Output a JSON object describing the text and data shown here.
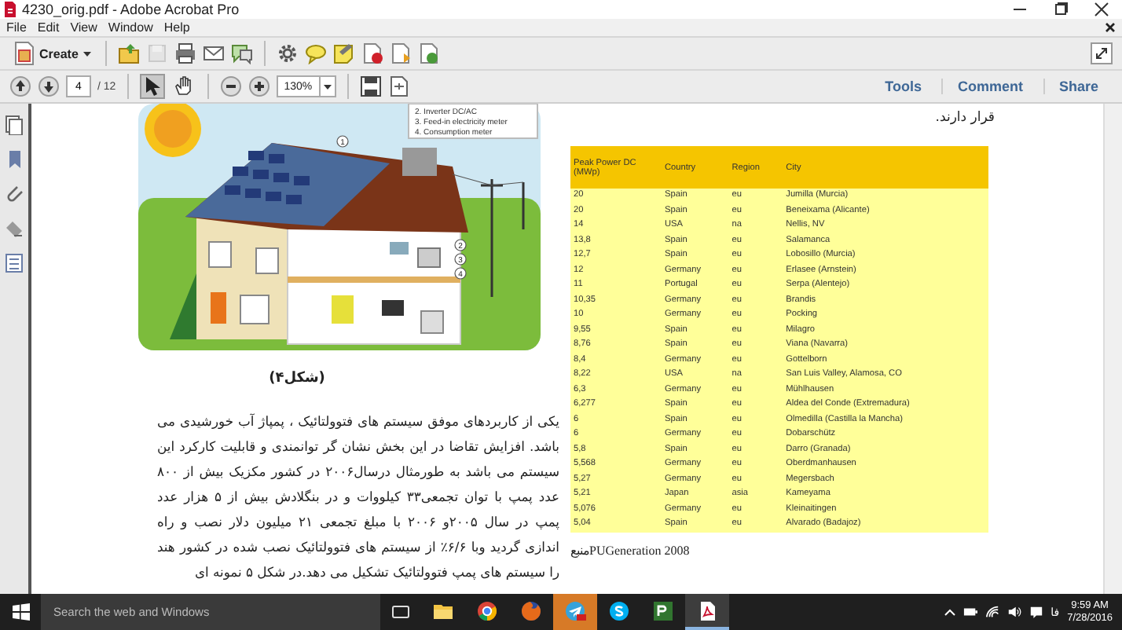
{
  "window": {
    "title": "4230_orig.pdf - Adobe Acrobat Pro"
  },
  "menu": [
    "File",
    "Edit",
    "View",
    "Window",
    "Help"
  ],
  "toolbar": {
    "create": "Create",
    "tools": [
      {
        "kind": "open"
      },
      {
        "kind": "save",
        "disabled": true
      },
      {
        "kind": "print"
      },
      {
        "kind": "mail"
      },
      {
        "kind": "review"
      },
      {
        "kind": "gear"
      },
      {
        "kind": "comment"
      },
      {
        "kind": "sticky"
      },
      {
        "kind": "stamp"
      },
      {
        "kind": "attach"
      },
      {
        "kind": "sign"
      }
    ]
  },
  "nav": {
    "page": "4",
    "total": "/ 12",
    "zoom": "130%",
    "pointers": [
      {
        "kind": "select",
        "selected": true
      },
      {
        "kind": "hand",
        "selected": false
      }
    ]
  },
  "panels": [
    "Tools",
    "Comment",
    "Share"
  ],
  "document": {
    "figure": {
      "legend": [
        "2. Inverter DC/AC",
        "3. Feed-in electricity meter",
        "4. Consumption meter"
      ],
      "markers": [
        "1",
        "2",
        "3",
        "4"
      ]
    },
    "caption": "(شکل۴)",
    "paragraph": "یکی از کاربردهای موفق سیستم های فتوولتائیک ، پمپاژ آب خورشیدی می باشد. افزایش تقاضا در این بخش نشان گر توانمندی و قابلیت کارکرد این سیستم می باشد به طورمثال درسال۲۰۰۶ در کشور مکزیک بیش از ۸۰۰ عدد پمپ با توان تجمعی۳۳ کیلووات و در بنگلادش بیش از ۵ هزار عدد پمپ در سال ۲۰۰۵و ۲۰۰۶ با مبلغ تجمعی ۲۱ میلیون دلار نصب و راه اندازی گردید وبا ۶/۶٪ از سیستم های فتوولتائیک نصب شده در کشور هند را سیستم های پمپ فتوولتائیک تشکیل می دهد.در شکل ۵ نمونه ای",
    "intro": "قرار دارند.",
    "table": {
      "columns": [
        "Peak Power DC (MWp)",
        "Country",
        "Region",
        "City"
      ],
      "rows": [
        [
          "20",
          "Spain",
          "eu",
          "Jumilla (Murcia)"
        ],
        [
          "20",
          "Spain",
          "eu",
          "Beneixama (Alicante)"
        ],
        [
          "14",
          "USA",
          "na",
          "Nellis, NV"
        ],
        [
          "13,8",
          "Spain",
          "eu",
          "Salamanca"
        ],
        [
          "12,7",
          "Spain",
          "eu",
          "Lobosillo (Murcia)"
        ],
        [
          "12",
          "Germany",
          "eu",
          "Erlasee (Arnstein)"
        ],
        [
          "11",
          "Portugal",
          "eu",
          "Serpa (Alentejo)"
        ],
        [
          "10,35",
          "Germany",
          "eu",
          "Brandis"
        ],
        [
          "10",
          "Germany",
          "eu",
          "Pocking"
        ],
        [
          "9,55",
          "Spain",
          "eu",
          "Milagro"
        ],
        [
          "8,76",
          "Spain",
          "eu",
          "Viana (Navarra)"
        ],
        [
          "8,4",
          "Germany",
          "eu",
          "Gottelborn"
        ],
        [
          "8,22",
          "USA",
          "na",
          "San Luis Valley, Alamosa, CO"
        ],
        [
          "6,3",
          "Germany",
          "eu",
          "Mühlhausen"
        ],
        [
          "6,277",
          "Spain",
          "eu",
          "Aldea del Conde (Extremadura)"
        ],
        [
          "6",
          "Spain",
          "eu",
          "Olmedilla (Castilla la Mancha)"
        ],
        [
          "6",
          "Germany",
          "eu",
          "Dobarschütz"
        ],
        [
          "5,8",
          "Spain",
          "eu",
          "Darro (Granada)"
        ],
        [
          "5,568",
          "Germany",
          "eu",
          "Oberdmanhausen"
        ],
        [
          "5,27",
          "Germany",
          "eu",
          "Megersbach"
        ],
        [
          "5,21",
          "Japan",
          "asia",
          "Kameyama"
        ],
        [
          "5,076",
          "Germany",
          "eu",
          "Kleinaitingen"
        ],
        [
          "5,04",
          "Spain",
          "eu",
          "Alvarado (Badajoz)"
        ]
      ]
    },
    "source": "منبعPUGeneration 2008"
  },
  "taskbar": {
    "search_placeholder": "Search the web and Windows",
    "apps": [
      {
        "kind": "explorer",
        "active": false,
        "flashing": false
      },
      {
        "kind": "chrome",
        "active": false,
        "flashing": false
      },
      {
        "kind": "firefox",
        "active": false,
        "flashing": false
      },
      {
        "kind": "telegram",
        "active": false,
        "flashing": true
      },
      {
        "kind": "skype",
        "active": false,
        "flashing": false
      },
      {
        "kind": "project",
        "active": false,
        "flashing": false
      },
      {
        "kind": "acrobat",
        "active": true,
        "flashing": false
      }
    ],
    "language": "فا",
    "time": "9:59 AM",
    "date": "7/28/2016"
  }
}
